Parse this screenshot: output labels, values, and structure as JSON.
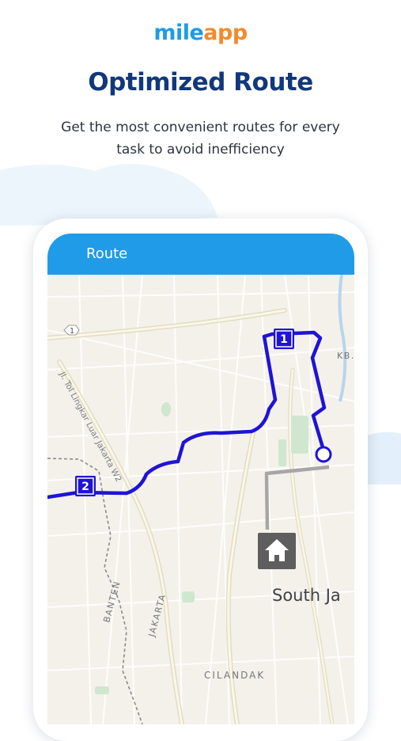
{
  "brand": {
    "part1": "mile",
    "part2": "app"
  },
  "headline": "Optimized Route",
  "subtitle": "Get the most convenient routes for every task to avoid inefficiency",
  "appbar": {
    "title": "Route"
  },
  "map": {
    "road_shield": "1",
    "stops": [
      "1",
      "2"
    ],
    "labels": {
      "kb": "KB.",
      "toll_road": "Jl. Tol Lingkar Luar Jakarta W2",
      "banten": "BANTEN",
      "jakarta": "JAKARTA",
      "south_jakarta": "South Ja",
      "cilandak": "CILANDAK"
    },
    "home_icon": "home-icon"
  },
  "colors": {
    "brand_blue": "#1e9be6",
    "brand_orange": "#f28a2e",
    "headline": "#12387c",
    "appbar": "#1f9be8",
    "route": "#1f14d6",
    "map_bg": "#f3f1ea"
  }
}
